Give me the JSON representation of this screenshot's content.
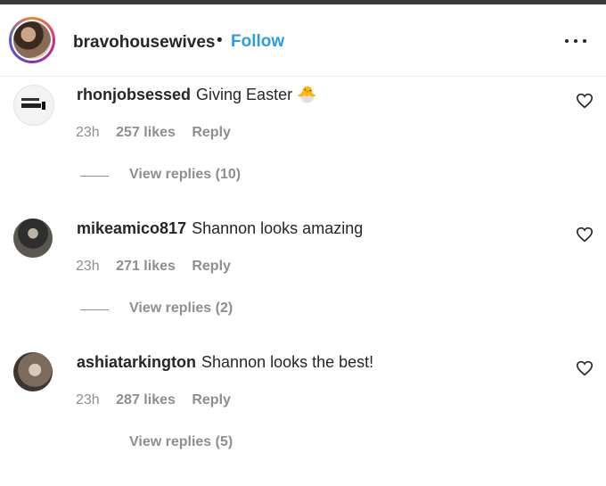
{
  "header": {
    "username": "bravohousewives",
    "separator": "•",
    "follow_label": "Follow",
    "more_icon": "more-horizontal-icon"
  },
  "comments": [
    {
      "username": "rhonjobsessed",
      "text": "Giving Easter 🐣",
      "time": "23h",
      "likes": "257 likes",
      "reply_label": "Reply",
      "view_replies": "View replies (10)"
    },
    {
      "username": "mikeamico817",
      "text": "Shannon looks amazing",
      "time": "23h",
      "likes": "271 likes",
      "reply_label": "Reply",
      "view_replies": "View replies (2)"
    },
    {
      "username": "ashiatarkington",
      "text": "Shannon looks the best!",
      "time": "23h",
      "likes": "287 likes",
      "reply_label": "Reply",
      "view_replies": "View replies (5)"
    }
  ],
  "colors": {
    "follow": "#2e9be6",
    "text": "#262626",
    "secondary": "#8e8e8e"
  }
}
